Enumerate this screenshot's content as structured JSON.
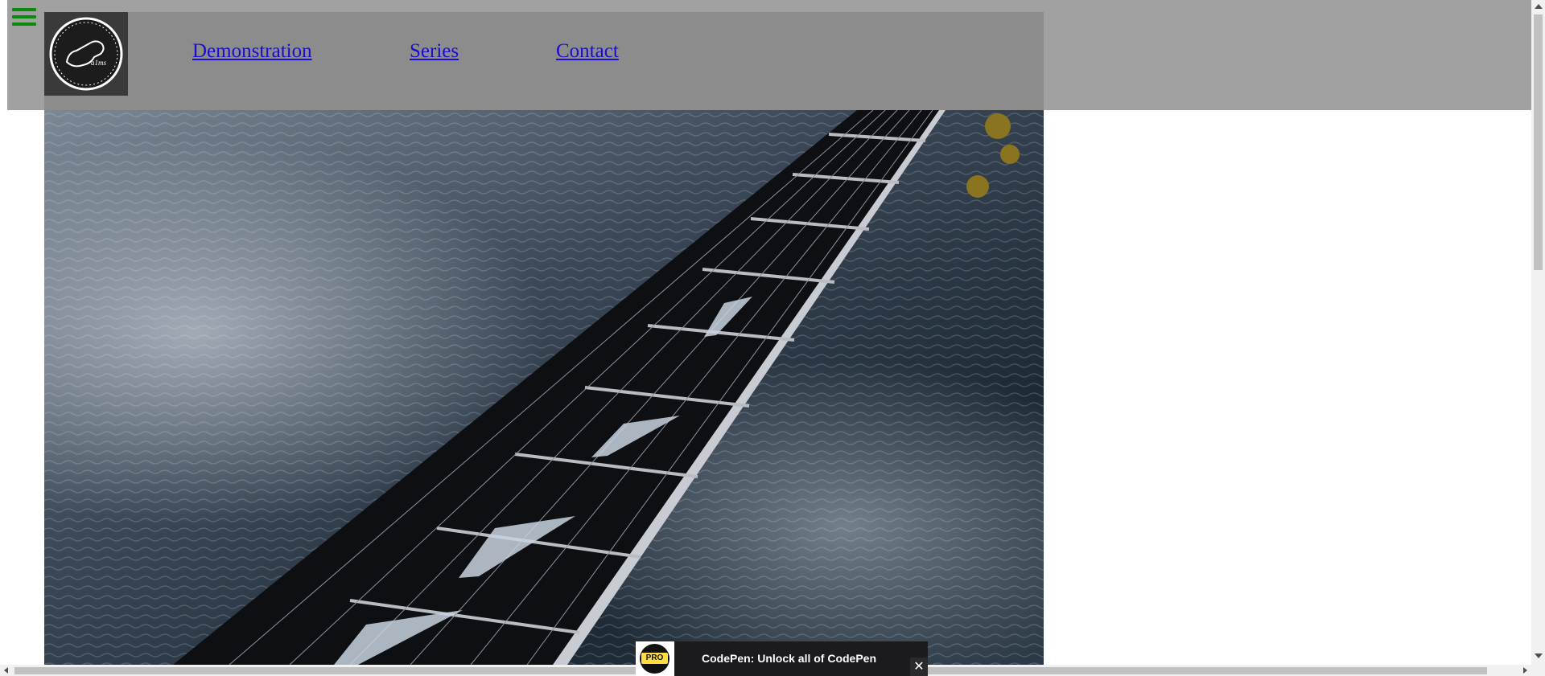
{
  "header": {
    "menu_icon": "hamburger-menu-icon",
    "logo_icon": "guitar-logo-icon",
    "nav": [
      {
        "label": "Demonstration"
      },
      {
        "label": "Series"
      },
      {
        "label": "Contact"
      }
    ]
  },
  "hero": {
    "image": "guitar-fretboard-photo"
  },
  "promo": {
    "badge": "PRO",
    "text": "CodePen: Unlock all of CodePen",
    "close_icon": "close-icon"
  },
  "colors": {
    "header_bg": "#a1a1a1",
    "header_inner_bg": "#8c8c8c",
    "link": "#1a0dcc",
    "menu_icon": "#0b8a0b",
    "promo_bg": "#1b1b1e",
    "pro_badge": "#ffdd40"
  }
}
